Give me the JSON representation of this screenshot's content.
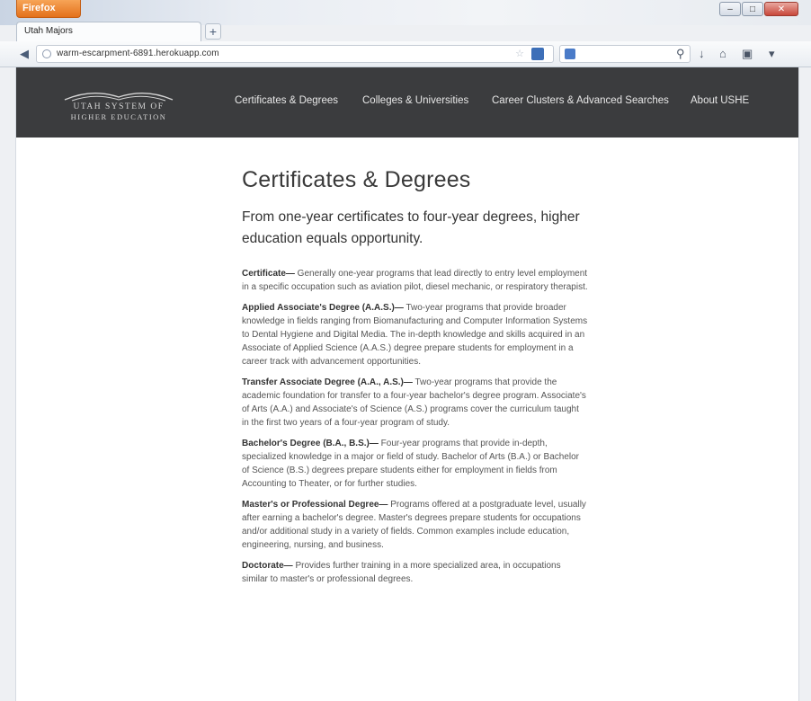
{
  "browser": {
    "menu_button": "Firefox",
    "tab_title": "Utah Majors",
    "url": "warm-escarpment-6891.herokuapp.com",
    "new_tab": "+",
    "window_controls": {
      "minimize": "–",
      "maximize": "□",
      "close": "✕"
    }
  },
  "site": {
    "logo": {
      "line1": "UTAH SYSTEM OF",
      "line2": "HIGHER EDUCATION"
    },
    "nav": [
      {
        "label": "Certificates & Degrees"
      },
      {
        "label": "Colleges & Universities"
      },
      {
        "label": "Career Clusters & Advanced Searches"
      },
      {
        "label": "About USHE"
      }
    ]
  },
  "main": {
    "title": "Certificates & Degrees",
    "subtitle": "From one-year certificates to four-year degrees, higher education equals opportunity.",
    "definitions": [
      {
        "term": "Certificate—",
        "text": " Generally one-year programs that lead directly to entry level employment in a specific occupation such as aviation pilot, diesel mechanic, or respiratory therapist."
      },
      {
        "term": "Applied Associate's Degree (A.A.S.)—",
        "text": " Two-year programs that provide broader knowledge in fields ranging from Biomanufacturing and Computer Information Systems to Dental Hygiene and Digital Media. The in-depth knowledge and skills acquired in an Associate of Applied Science (A.A.S.) degree prepare students for employment in a career track with advancement opportunities."
      },
      {
        "term": "Transfer Associate Degree (A.A., A.S.)—",
        "text": " Two-year programs that provide the academic foundation for transfer to a four-year bachelor's degree program. Associate's of Arts (A.A.) and Associate's of Science (A.S.) programs cover the curriculum taught in the first two years of a four-year program of study."
      },
      {
        "term": "Bachelor's Degree (B.A., B.S.)—",
        "text": " Four-year programs that provide in-depth, specialized knowledge in a major or field of study. Bachelor of Arts (B.A.) or Bachelor of Science (B.S.) degrees prepare students either for employment in fields from Accounting to Theater, or for further studies."
      },
      {
        "term": "Master's or Professional Degree—",
        "text": " Programs offered at a postgraduate level, usually after earning a bachelor's degree. Master's degrees prepare students for occupations and/or additional study in a variety of fields. Common examples include education, engineering, nursing, and business."
      },
      {
        "term": "Doctorate—",
        "text": " Provides further training in a more specialized area, in occupations similar to master's or professional degrees."
      }
    ]
  }
}
